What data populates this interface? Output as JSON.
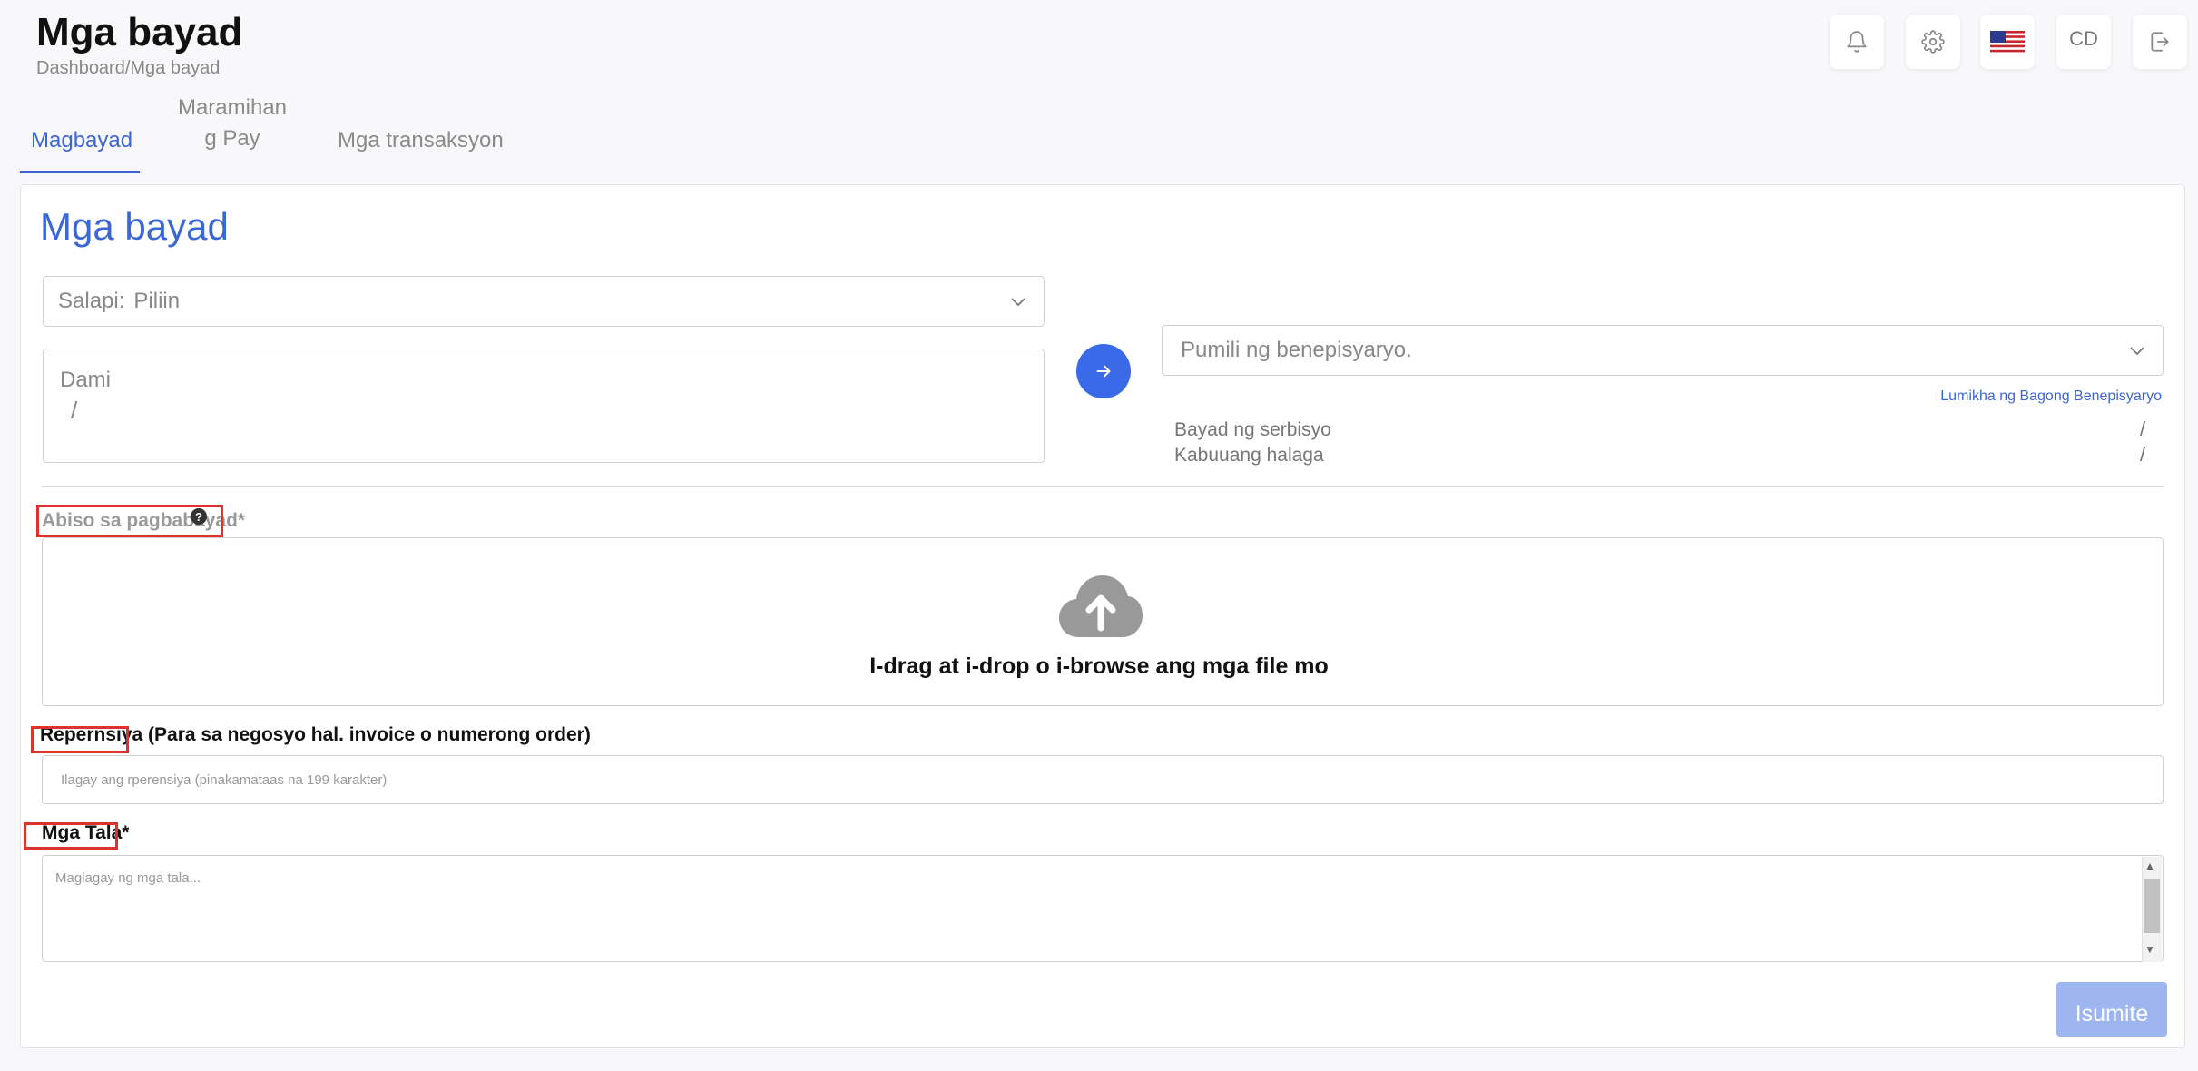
{
  "header": {
    "title": "Mga bayad",
    "breadcrumb": "Dashboard/Mga bayad",
    "user_initials": "CD",
    "icons": [
      "bell-icon",
      "gear-icon",
      "us-flag-icon",
      "logout-icon"
    ]
  },
  "tabs": [
    {
      "label": "Magbayad",
      "active": true
    },
    {
      "label_line1": "Maramihan",
      "label_line2": "g Pay",
      "active": false
    },
    {
      "label": "Mga transaksyon",
      "active": false
    }
  ],
  "card": {
    "title": "Mga bayad",
    "currency": {
      "label": "Salapi:",
      "value": "Piliin"
    },
    "amount": {
      "label": "Dami",
      "value": "/"
    },
    "beneficiary": {
      "placeholder": "Pumili ng benepisyaryo.",
      "create_link": "Lumikha ng Bagong Benepisyaryo"
    },
    "fees": [
      {
        "label": "Bayad ng serbisyo",
        "value": "/"
      },
      {
        "label": "Kabuuang halaga",
        "value": "/"
      }
    ],
    "notice": {
      "label": "Abiso sa pagbabayad*",
      "help": "?",
      "dropzone_text": "I-drag  at i-drop  o i-browse  ang mga file mo"
    },
    "reference": {
      "label": "Repernsiya (Para sa negosyo hal. invoice o numerong order)",
      "placeholder": "Ilagay ang rperensiya (pinakamataas na 199 karakter)"
    },
    "notes": {
      "label": "Mga Tala*",
      "placeholder": "Maglagay ng mga tala..."
    },
    "submit_label": "Isumite"
  },
  "colors": {
    "accent": "#3b66d6",
    "button_blue": "#3b6ae8",
    "submit_disabled": "#9db6f0",
    "highlight": "#e0322d"
  }
}
